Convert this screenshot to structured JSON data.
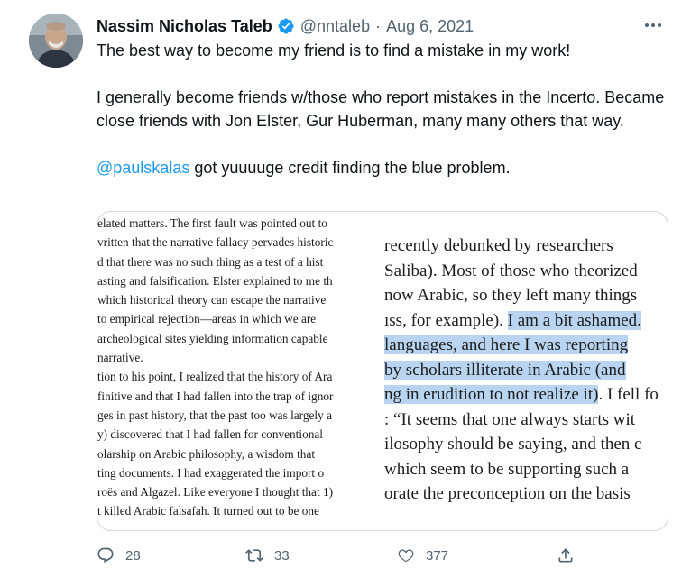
{
  "tweet": {
    "author_name": "Nassim Nicholas Taleb",
    "handle": "@nntaleb",
    "separator": "·",
    "date": "Aug 6, 2021",
    "line1": "The best way to become my friend is to find a mistake in my work!",
    "para2": "I generally become friends w/those who report mistakes in the Incerto. Became close friends with Jon Elster, Gur Huberman, many many others that way.",
    "mention": "@paulskalas",
    "para3_rest": " got yuuuuge credit finding the blue problem."
  },
  "media": {
    "left_lines": [
      "elated matters. The first fault was pointed out to",
      "vritten that the narrative fallacy pervades historic",
      "d that there was no such thing as a test of a hist",
      "asting and falsification. Elster explained to me th",
      "which historical theory can escape the narrative",
      "to empirical rejection—areas in which we are",
      " archeological sites yielding information capable",
      "narrative.",
      "tion to his point, I realized that the history of Ara",
      "finitive and that I had fallen into the trap of ignor",
      "ges in past history, that the past too was largely a",
      "y) discovered that I had fallen for conventional",
      "olarship on Arabic philosophy, a wisdom that",
      "ting documents. I had exaggerated the import o",
      "roës and Algazel. Like everyone I thought that 1)",
      "t killed Arabic falsafah. It turned out to be one"
    ],
    "right_lines": [
      {
        "plain": " recently debunked by researchers",
        "hl": "",
        "after": ""
      },
      {
        "plain": "Saliba). Most of those who theorized",
        "hl": "",
        "after": ""
      },
      {
        "plain": "now Arabic, so they left many things",
        "hl": "",
        "after": ""
      },
      {
        "plain": "ıss, for example). ",
        "hl": "I am a bit ashamed.",
        "after": ""
      },
      {
        "plain": "",
        "hl": "languages, and here I was reporting",
        "after": ""
      },
      {
        "plain": "",
        "hl": " by scholars illiterate in Arabic (and",
        "after": ""
      },
      {
        "plain": "",
        "hl": "ng in erudition to not realize it)",
        "after": ". I fell fo"
      },
      {
        "plain": ": “It seems that one always starts wit",
        "hl": "",
        "after": ""
      },
      {
        "plain": "ilosophy should be saying, and then c",
        "hl": "",
        "after": ""
      },
      {
        "plain": " which seem to be supporting such a",
        "hl": "",
        "after": ""
      },
      {
        "plain": "orate the preconception on the basis",
        "hl": "",
        "after": ""
      }
    ]
  },
  "actions": {
    "reply_count": "28",
    "retweet_count": "33",
    "like_count": "377"
  },
  "icons": [
    "verified-badge-icon",
    "more-icon",
    "reply-icon",
    "retweet-icon",
    "like-icon",
    "share-icon"
  ],
  "colors": {
    "accent": "#1d9bf0",
    "muted": "#536471",
    "highlight": "#b8d4f0"
  }
}
